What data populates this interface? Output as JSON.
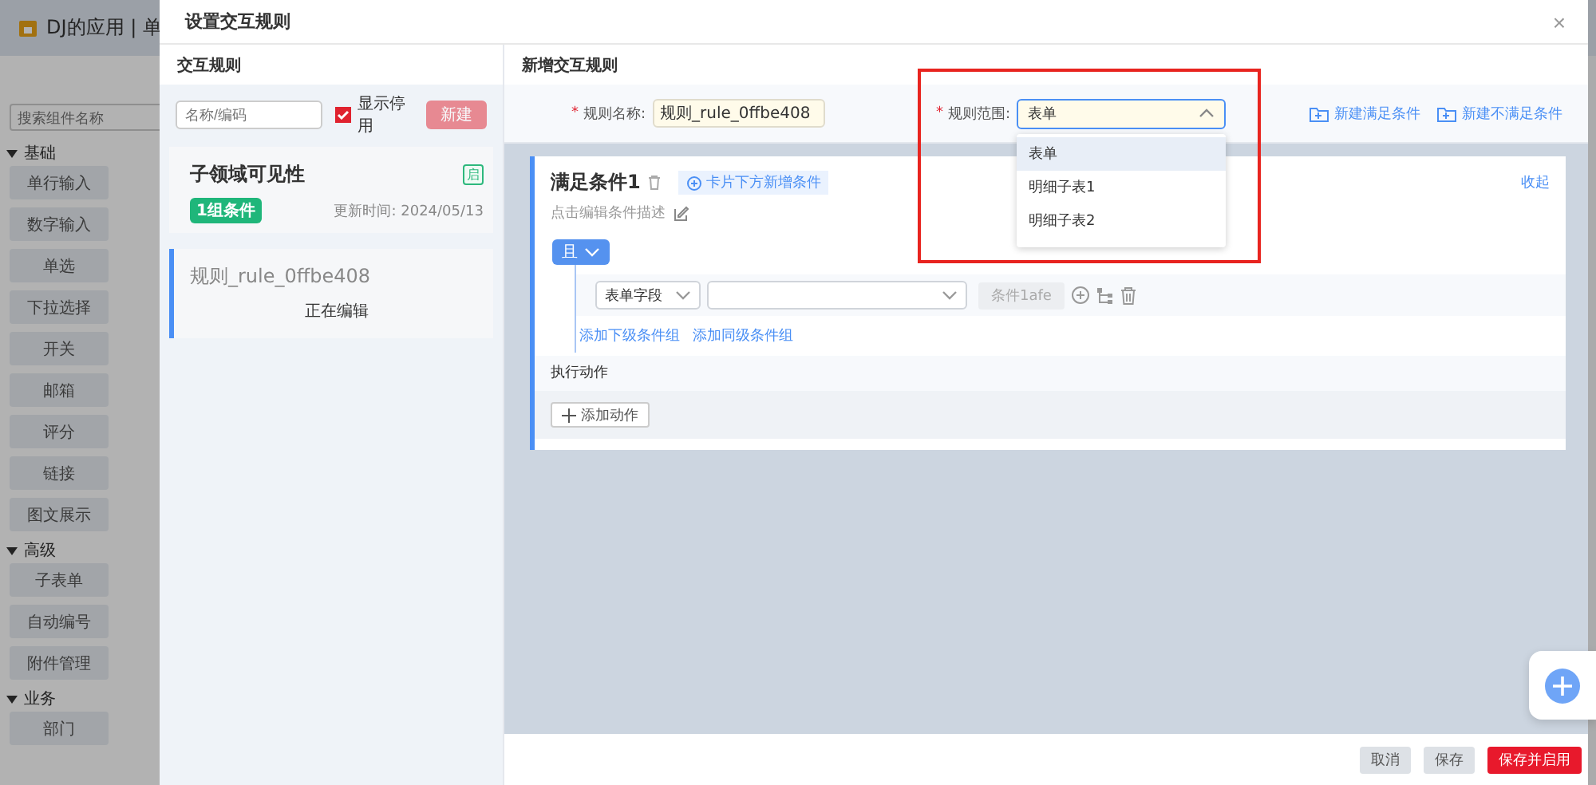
{
  "background_app": {
    "title": "DJ的应用 | 单",
    "search": {
      "placeholder": "搜索组件名称"
    },
    "groups": [
      {
        "label": "基础",
        "expanded": true,
        "items": [
          "单行输入",
          "数字输入",
          "单选",
          "下拉选择",
          "开关",
          "邮箱",
          "评分",
          "链接",
          "图文展示"
        ]
      },
      {
        "label": "高级",
        "expanded": true,
        "items": [
          "子表单",
          "自动编号",
          "附件管理"
        ]
      },
      {
        "label": "业务",
        "expanded": true,
        "items": [
          "部门"
        ]
      }
    ]
  },
  "dialog": {
    "title": "设置交互规则",
    "close": "×",
    "rule_list": {
      "title": "交互规则",
      "search": {
        "placeholder": "名称/编码"
      },
      "show_disabled": {
        "label": "显示停用",
        "checked": true
      },
      "new_button": {
        "label": "新建",
        "disabled": true
      },
      "rules": [
        {
          "name": "子领域可见性",
          "status": "启",
          "conditions": "1组条件",
          "updated": "更新时间: 2024/05/13",
          "selected": false
        },
        {
          "name": "规则_rule_0ffbe408",
          "note": "正在编辑",
          "selected": true
        }
      ]
    },
    "editor": {
      "title": "新增交互规则",
      "name_field": {
        "label": "规则名称:",
        "required_mark": "*",
        "value": "规则_rule_0ffbe408"
      },
      "scope_field": {
        "label": "规则范围:",
        "required_mark": "*",
        "value": "表单",
        "expanded": true,
        "highlighted": true,
        "options": [
          {
            "label": "表单",
            "selected": true
          },
          {
            "label": "明细子表1",
            "selected": false
          },
          {
            "label": "明细子表2",
            "selected": false
          }
        ]
      },
      "actions": [
        "新建满足条件",
        "新建不满足条件"
      ],
      "condition": {
        "title": "满足条件1",
        "add_below": "卡片下方新增条件",
        "collapse": "收起",
        "description": "点击编辑条件描述",
        "logic": "且",
        "rows": [
          {
            "field_type": "表单字段",
            "tag": "条件1afe"
          }
        ],
        "links": [
          "添加下级条件组",
          "添加同级条件组"
        ]
      },
      "action_section": {
        "title": "执行动作",
        "add_button": "添加动作"
      }
    },
    "footer": {
      "buttons": [
        {
          "label": "取消",
          "kind": "default"
        },
        {
          "label": "保存",
          "kind": "default"
        },
        {
          "label": "保存并启用",
          "kind": "primary"
        }
      ]
    }
  }
}
